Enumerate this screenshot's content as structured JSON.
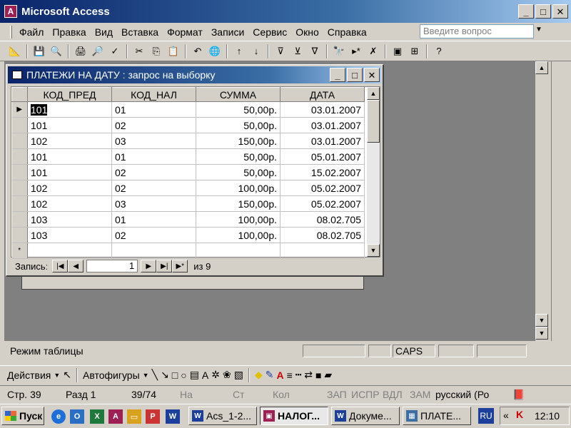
{
  "app": {
    "title": "Microsoft Access",
    "icon_letter": "A"
  },
  "menu": [
    "Файл",
    "Правка",
    "Вид",
    "Вставка",
    "Формат",
    "Записи",
    "Сервис",
    "Окно",
    "Справка"
  ],
  "ask_placeholder": "Введите вопрос",
  "query_window": {
    "title": "ПЛАТЕЖИ НА ДАТУ : запрос на выборку",
    "columns": [
      "КОД_ПРЕД",
      "КОД_НАЛ",
      "СУММА",
      "ДАТА"
    ],
    "rows": [
      [
        "101",
        "01",
        "50,00р.",
        "03.01.2007"
      ],
      [
        "101",
        "02",
        "50,00р.",
        "03.01.2007"
      ],
      [
        "102",
        "03",
        "150,00р.",
        "03.01.2007"
      ],
      [
        "101",
        "01",
        "50,00р.",
        "05.01.2007"
      ],
      [
        "101",
        "02",
        "50,00р.",
        "15.02.2007"
      ],
      [
        "102",
        "02",
        "100,00р.",
        "05.02.2007"
      ],
      [
        "102",
        "03",
        "150,00р.",
        "05.02.2007"
      ],
      [
        "103",
        "01",
        "100,00р.",
        "08.02.705"
      ],
      [
        "103",
        "02",
        "100,00р.",
        "08.02.705"
      ]
    ],
    "new_row_marker": "*",
    "current_row_marker": "▶",
    "nav": {
      "label": "Запись:",
      "current": "1",
      "total_text": "из 9"
    }
  },
  "status": {
    "mode": "Режим таблицы",
    "caps": "CAPS"
  },
  "drawing": {
    "actions": "Действия",
    "autoshapes": "Автофигуры"
  },
  "word_status": {
    "page": "Стр. 39",
    "section": "Разд 1",
    "pages": "39/74",
    "at": "На",
    "line": "Ст",
    "col": "Кол",
    "rec": "ЗАП",
    "trk": "ИСПР",
    "ext": "ВДЛ",
    "ovr": "ЗАМ",
    "language": "русский (Ро"
  },
  "taskbar": {
    "start": "Пуск",
    "tasks": [
      "Acs_1-2...",
      "НАЛОГ...",
      "Докуме...",
      "ПЛАТЕ..."
    ],
    "lang": "RU",
    "time": "12:10"
  }
}
